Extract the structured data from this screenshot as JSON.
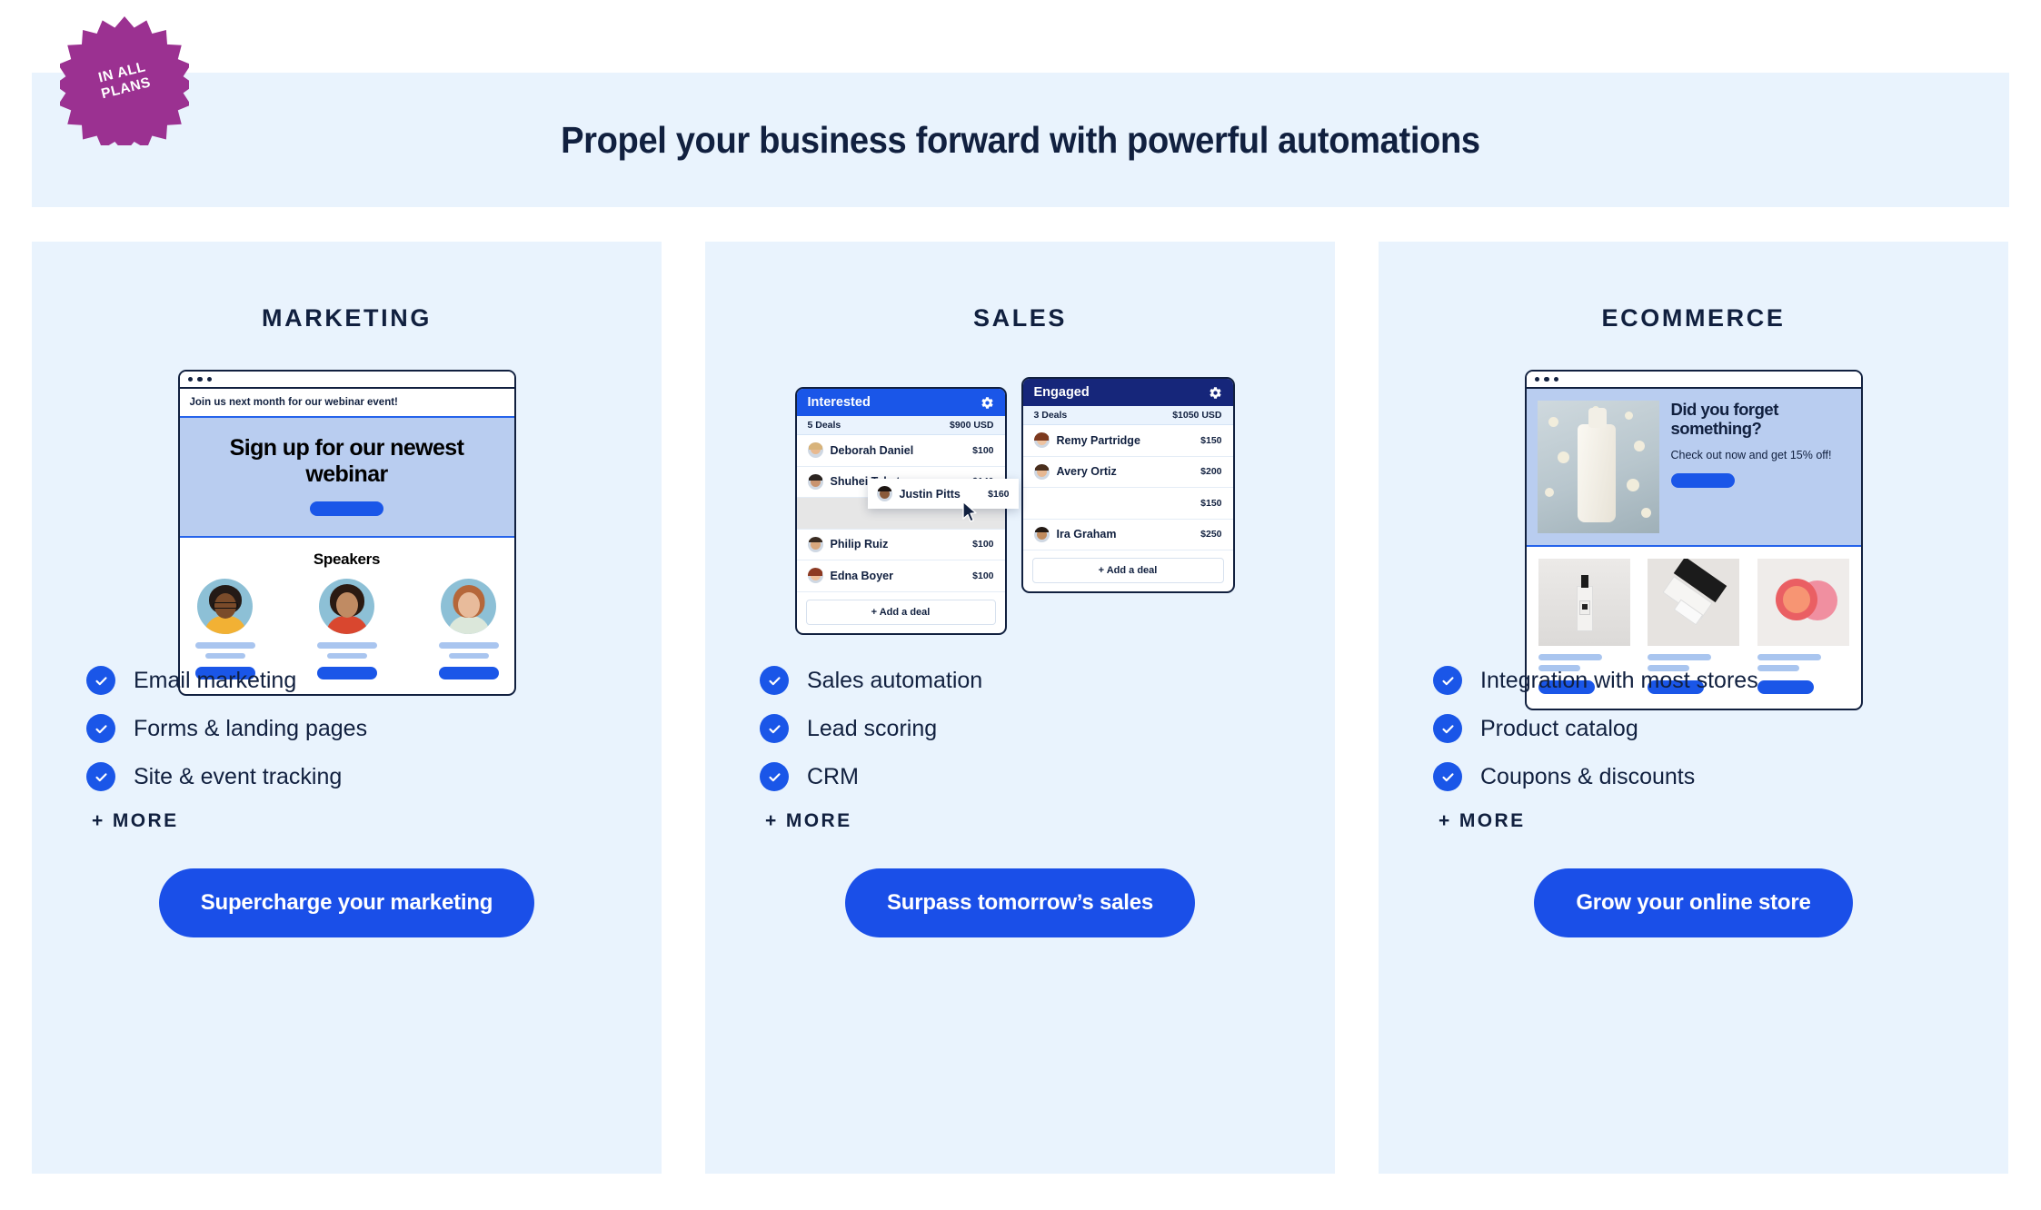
{
  "badge": {
    "line1": "IN ALL",
    "line2": "PLANS",
    "color": "#9b3191"
  },
  "header": {
    "title": "Propel your business forward with powerful automations",
    "background": "#e9f3fd"
  },
  "theme": {
    "accent": "#1a56e8",
    "panel": "#e9f3fd",
    "ink": "#11203f",
    "navy": "#16267a"
  },
  "columns": [
    {
      "id": "marketing",
      "title": "MARKETING",
      "mockup": {
        "type": "email-builder",
        "preheader": "Join us next month for our webinar event!",
        "hero_title": "Sign up for our newest webinar",
        "section_title": "Speakers",
        "speakers": [
          "speaker-1",
          "speaker-2",
          "speaker-3"
        ]
      },
      "features": [
        "Email marketing",
        "Forms & landing pages",
        "Site & event tracking"
      ],
      "more_label": "+ MORE",
      "cta": "Supercharge your marketing"
    },
    {
      "id": "sales",
      "title": "SALES",
      "mockup": {
        "type": "crm-kanban",
        "boards": [
          {
            "name": "Interested",
            "header_color": "#1a56e8",
            "deal_count": "5 Deals",
            "total": "$900 USD",
            "deals": [
              {
                "name": "Deborah Daniel",
                "amount": "$100"
              },
              {
                "name": "Shuhei Takata",
                "amount": "$140"
              },
              {
                "name": "",
                "amount": ""
              },
              {
                "name": "Philip Ruiz",
                "amount": "$100"
              },
              {
                "name": "Edna Boyer",
                "amount": "$100"
              }
            ],
            "add_label": "+ Add a deal"
          },
          {
            "name": "Engaged",
            "header_color": "#16267a",
            "deal_count": "3 Deals",
            "total": "$1050 USD",
            "deals": [
              {
                "name": "Remy Partridge",
                "amount": "$150"
              },
              {
                "name": "Avery Ortiz",
                "amount": "$200"
              },
              {
                "name": "",
                "amount": "$150"
              },
              {
                "name": "Ira Graham",
                "amount": "$250"
              }
            ],
            "add_label": "+ Add a deal"
          }
        ],
        "dragged_card": {
          "name": "Justin Pitts",
          "amount": "$160"
        }
      },
      "features": [
        "Sales automation",
        "Lead scoring",
        "CRM"
      ],
      "more_label": "+ MORE",
      "cta": "Surpass tomorrow’s sales"
    },
    {
      "id": "ecommerce",
      "title": "ECOMMERCE",
      "mockup": {
        "type": "abandoned-cart-email",
        "hero_title": "Did you forget something?",
        "hero_text": "Check out now and get 15% off!",
        "products": [
          "product-perfume",
          "product-skincare-box",
          "product-lip-balm"
        ]
      },
      "features": [
        "Integration with most stores",
        "Product catalog",
        "Coupons & discounts"
      ],
      "more_label": "+ MORE",
      "cta": "Grow your online store"
    }
  ]
}
